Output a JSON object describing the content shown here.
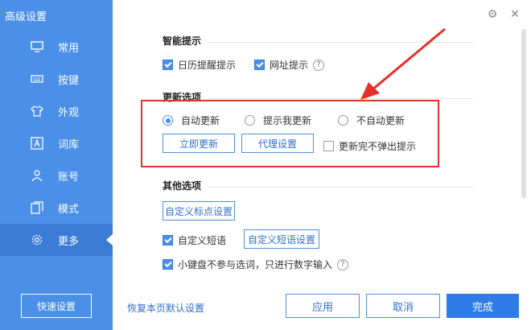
{
  "window": {
    "title": "高级设置",
    "close_glyph": "✕",
    "settings_glyph": "⚙"
  },
  "sidebar": {
    "items": [
      {
        "label": "常用",
        "icon": "monitor-icon"
      },
      {
        "label": "按键",
        "icon": "keyboard-icon"
      },
      {
        "label": "外观",
        "icon": "tshirt-icon"
      },
      {
        "label": "词库",
        "icon": "letter-a-icon"
      },
      {
        "label": "账号",
        "icon": "user-icon"
      },
      {
        "label": "模式",
        "icon": "layers-icon"
      },
      {
        "label": "更多",
        "icon": "gear-icon",
        "active": true
      }
    ],
    "quick_settings_label": "快速设置"
  },
  "sections": {
    "smart_tips": {
      "title": "智能提示",
      "calendar_tip": {
        "label": "日历提醒提示",
        "checked": true
      },
      "url_tip": {
        "label": "网址提示",
        "checked": true
      }
    },
    "update": {
      "title": "更新选项",
      "options": [
        {
          "label": "自动更新",
          "selected": true
        },
        {
          "label": "提示我更新",
          "selected": false
        },
        {
          "label": "不自动更新",
          "selected": false
        }
      ],
      "update_now_label": "立即更新",
      "proxy_label": "代理设置",
      "no_popup": {
        "label": "更新完不弹出提示",
        "checked": false
      }
    },
    "other": {
      "title": "其他选项",
      "custom_punct_label": "自定义标点设置",
      "custom_phrase": {
        "label": "自定义短语",
        "checked": true
      },
      "custom_phrase_settings_label": "自定义短语设置",
      "keypad": {
        "label": "小键盘不参与选词，只进行数字输入",
        "checked": true
      }
    }
  },
  "footer": {
    "reset_label": "恢复本页默认设置",
    "apply_label": "应用",
    "cancel_label": "取消",
    "done_label": "完成"
  },
  "help_glyph": "?",
  "colors": {
    "sidebar": "#4a8fe8",
    "accent": "#2f7ce8",
    "highlight": "#e5302a"
  }
}
